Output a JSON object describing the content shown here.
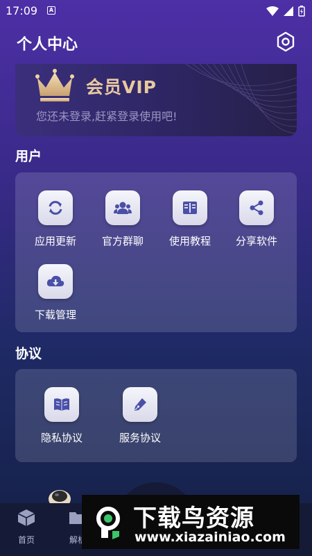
{
  "status": {
    "time": "17:09",
    "notif_letter": "A"
  },
  "header": {
    "title": "个人中心"
  },
  "vip": {
    "title": "会员VIP",
    "subtitle": "您还未登录,赶紧登录使用吧!"
  },
  "user_section": {
    "label": "用户",
    "items": [
      {
        "label": "应用更新",
        "icon": "refresh-icon"
      },
      {
        "label": "官方群聊",
        "icon": "group-icon"
      },
      {
        "label": "使用教程",
        "icon": "book-icon"
      },
      {
        "label": "分享软件",
        "icon": "share-icon"
      },
      {
        "label": "下载管理",
        "icon": "cloud-download-icon"
      }
    ]
  },
  "agreement_section": {
    "label": "协议",
    "items": [
      {
        "label": "隐私协议",
        "icon": "open-book-icon"
      },
      {
        "label": "服务协议",
        "icon": "pen-icon"
      }
    ]
  },
  "tabbar": {
    "items": [
      {
        "label": "首页",
        "icon": "cube-icon"
      },
      {
        "label": "解析",
        "icon": "folder-icon"
      }
    ]
  },
  "watermark": {
    "title": "下载鸟资源",
    "url": "www.xiazainiao.com"
  },
  "colors": {
    "accent_gold": "#e8c9a0",
    "icon_fg": "#4a4fa8"
  }
}
